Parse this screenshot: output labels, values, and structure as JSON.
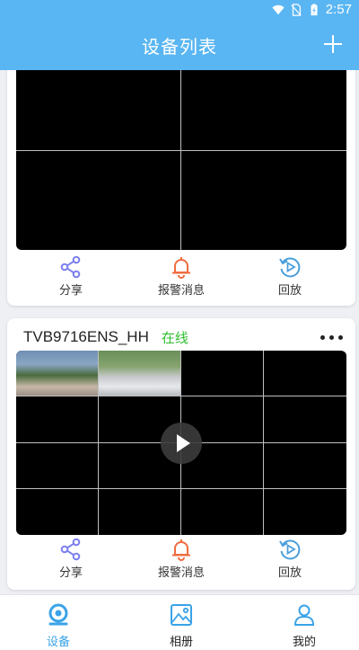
{
  "status_bar": {
    "time": "2:57",
    "icons": [
      "wifi-icon",
      "no-sim-icon",
      "battery-charging-icon"
    ]
  },
  "header": {
    "title": "设备列表",
    "add_icon": "plus-icon"
  },
  "colors": {
    "primary": "#5ab6f2",
    "online": "#2fbf2f",
    "alarm": "#ef6c3e",
    "share": "#7a7ef0",
    "playback": "#4a9fdc"
  },
  "devices": [
    {
      "name": "",
      "status": "",
      "grid": "2x2",
      "actions": [
        {
          "label": "分享",
          "icon": "share-icon"
        },
        {
          "label": "报警消息",
          "icon": "bell-icon"
        },
        {
          "label": "回放",
          "icon": "replay-icon"
        }
      ]
    },
    {
      "name": "TVB9716ENS_HH",
      "status": "在线",
      "grid": "4x4",
      "actions": [
        {
          "label": "分享",
          "icon": "share-icon"
        },
        {
          "label": "报警消息",
          "icon": "bell-icon"
        },
        {
          "label": "回放",
          "icon": "replay-icon"
        }
      ]
    }
  ],
  "tabs": [
    {
      "label": "设备",
      "icon": "camera-icon",
      "active": true
    },
    {
      "label": "相册",
      "icon": "photo-album-icon",
      "active": false
    },
    {
      "label": "我的",
      "icon": "user-icon",
      "active": false
    }
  ]
}
